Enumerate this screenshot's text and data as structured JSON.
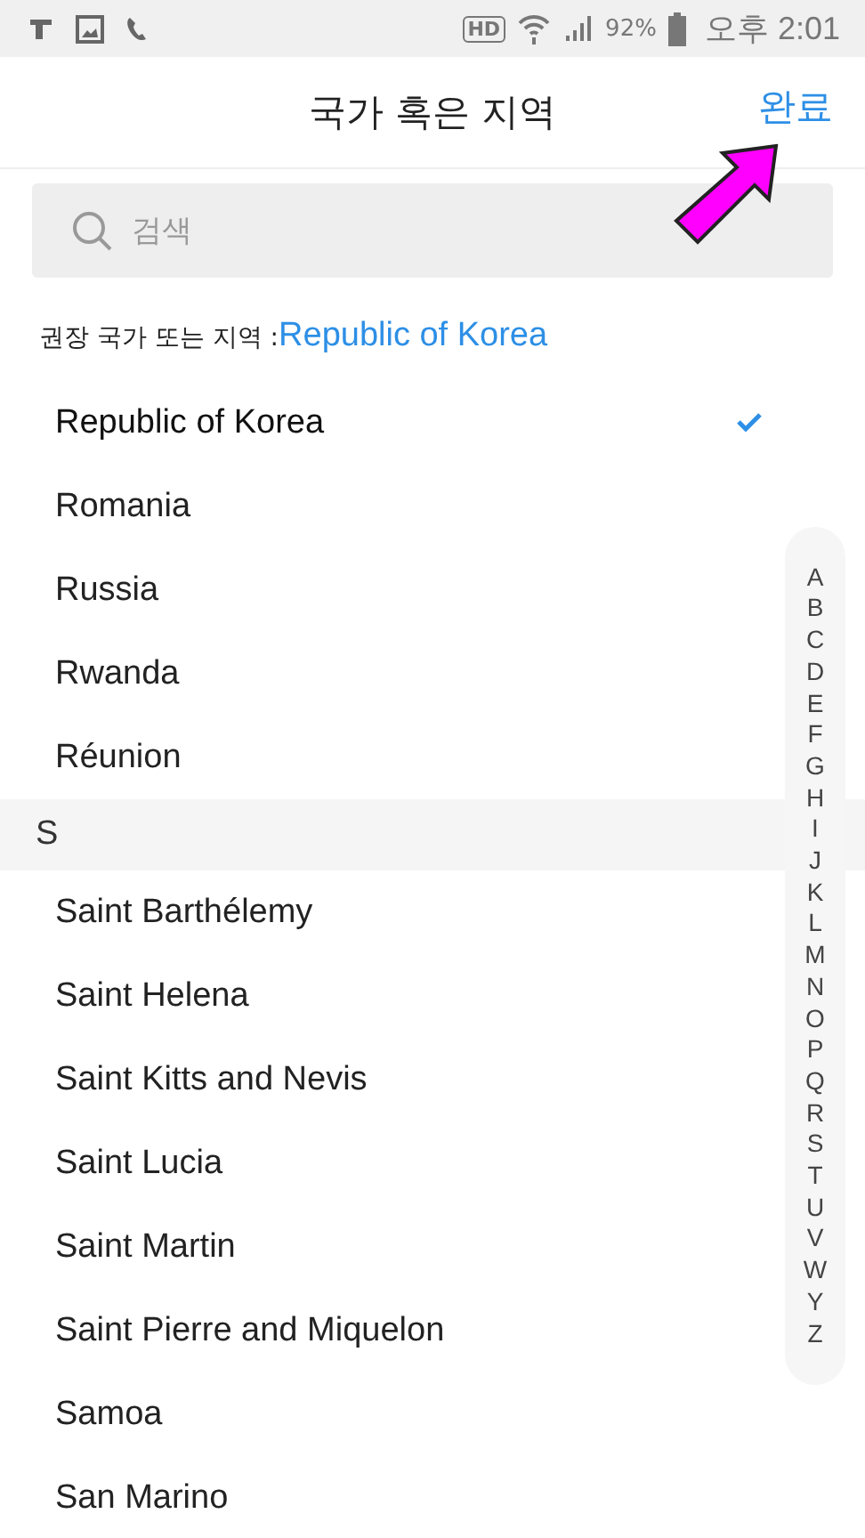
{
  "status_bar": {
    "hd": "HD",
    "battery": "92%",
    "time": "오후 2:01"
  },
  "header": {
    "title": "국가 혹은 지역",
    "done": "완료"
  },
  "search": {
    "placeholder": "검색"
  },
  "recommended": {
    "label": "권장 국가 또는 지역 :",
    "value": "Republic of Korea"
  },
  "list": [
    {
      "kind": "country",
      "name": "Republic of Korea",
      "selected": true
    },
    {
      "kind": "country",
      "name": "Romania",
      "selected": false
    },
    {
      "kind": "country",
      "name": "Russia",
      "selected": false
    },
    {
      "kind": "country",
      "name": "Rwanda",
      "selected": false
    },
    {
      "kind": "country",
      "name": "Réunion",
      "selected": false
    },
    {
      "kind": "section",
      "name": "S"
    },
    {
      "kind": "country",
      "name": "Saint Barthélemy",
      "selected": false
    },
    {
      "kind": "country",
      "name": "Saint Helena",
      "selected": false
    },
    {
      "kind": "country",
      "name": "Saint Kitts and Nevis",
      "selected": false
    },
    {
      "kind": "country",
      "name": "Saint Lucia",
      "selected": false
    },
    {
      "kind": "country",
      "name": "Saint Martin",
      "selected": false
    },
    {
      "kind": "country",
      "name": "Saint Pierre and Miquelon",
      "selected": false
    },
    {
      "kind": "country",
      "name": "Samoa",
      "selected": false
    },
    {
      "kind": "country",
      "name": "San Marino",
      "selected": false
    }
  ],
  "index": [
    "A",
    "B",
    "C",
    "D",
    "E",
    "F",
    "G",
    "H",
    "I",
    "J",
    "K",
    "L",
    "M",
    "N",
    "O",
    "P",
    "Q",
    "R",
    "S",
    "T",
    "U",
    "V",
    "W",
    "Y",
    "Z"
  ]
}
